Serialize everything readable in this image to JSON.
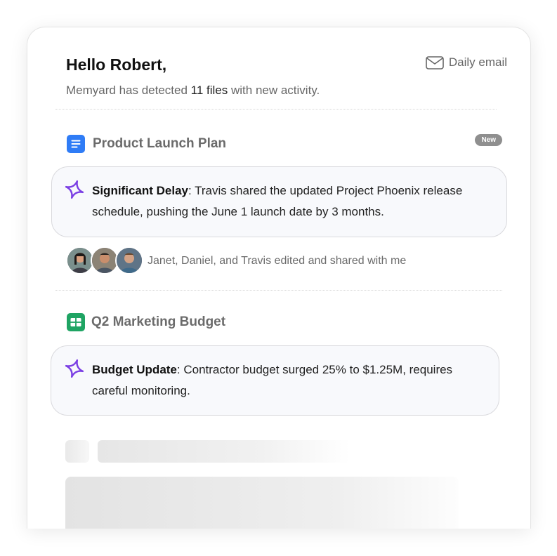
{
  "header": {
    "greeting": "Hello Robert,",
    "subtitle_prefix": "Memyard has detected ",
    "subtitle_count": "11 files",
    "subtitle_suffix": " with new activity.",
    "daily_email_label": "Daily email",
    "daily_email_icon": "mail-icon"
  },
  "files": [
    {
      "title": "Product Launch Plan",
      "icon": "google-docs-icon",
      "icon_color": "#2f7cf6",
      "badge": "New",
      "insight_title": "Significant Delay",
      "insight_text": ": Travis shared the updated Project Phoenix release schedule, pushing the June 1 launch date by 3 months.",
      "editors_text": "Janet, Daniel, and Travis edited and shared with me"
    },
    {
      "title": "Q2 Marketing Budget",
      "icon": "google-sheets-icon",
      "icon_color": "#1fa463",
      "insight_title": "Budget Update",
      "insight_text": ": Contractor budget surged 25% to $1.25M, requires careful monitoring."
    }
  ],
  "colors": {
    "accent_purple": "#7b3fe4",
    "badge_gray": "#8f8f8f"
  }
}
